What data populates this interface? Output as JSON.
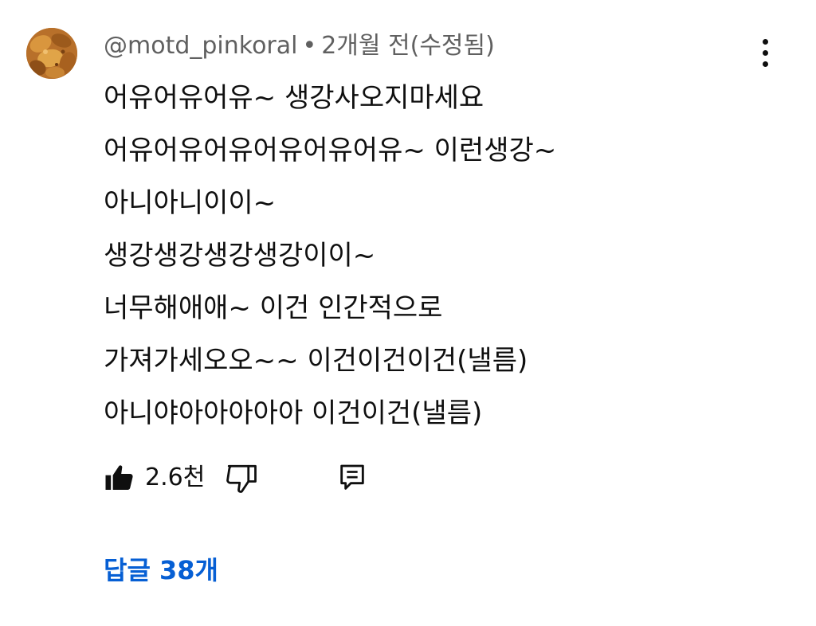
{
  "comment": {
    "author": "@motd_pinkoral",
    "separator": "•",
    "time": "2개월 전(수정됨)",
    "lines": [
      "어유어유어유~ 생강사오지마세요",
      "어유어유어유어유어유어유~ 이런생강~",
      "아니아니이이~",
      "생강생강생강생강이이~",
      "너무해애애~ 이건 인간적으로",
      "가져가세오오~~ 이건이건이건(낼름)",
      "아니야아아아아아 이건이건(낼름)"
    ],
    "actions": {
      "like_count": "2.6천",
      "like_icon": "thumbs-up-filled-icon",
      "dislike_icon": "thumbs-down-outline-icon",
      "reply_icon": "comment-reply-icon",
      "menu_icon": "more-vertical-icon"
    },
    "replies_label": "답글 38개",
    "colors": {
      "meta": "#606060",
      "text": "#0f0f0f",
      "link": "#065fd4"
    }
  }
}
